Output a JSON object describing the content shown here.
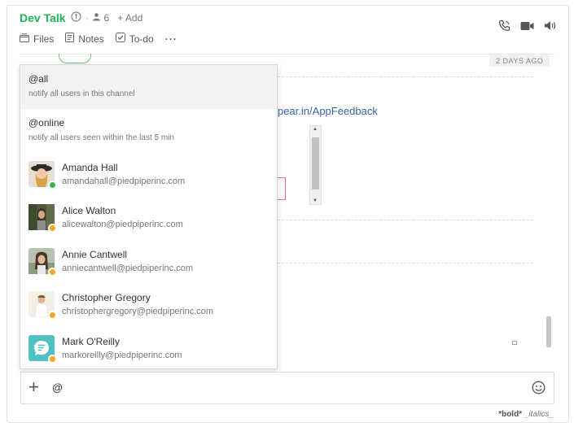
{
  "header": {
    "channel_name": "Dev Talk",
    "member_count": "6",
    "add_label": "+ Add",
    "tabs": [
      {
        "label": "Files",
        "icon": "files-icon"
      },
      {
        "label": "Notes",
        "icon": "notes-icon"
      },
      {
        "label": "To-do",
        "icon": "todo-icon"
      }
    ],
    "more": "···"
  },
  "timeline": {
    "date_pill": "2 DAYS AGO",
    "partial_link": "pear.in/AppFeedback"
  },
  "mention_popup": {
    "options": [
      {
        "handle": "@all",
        "desc": "notify all users in this channel"
      },
      {
        "handle": "@online",
        "desc": "notify all users seen within the last 5 min"
      }
    ],
    "users": [
      {
        "name": "Amanda Hall",
        "email": "amandahall@piedpiperinc.com",
        "status": "online"
      },
      {
        "name": "Alice Walton",
        "email": "alicewalton@piedpiperinc.com",
        "status": "away"
      },
      {
        "name": "Annie Cantwell",
        "email": "anniecantwell@piedpiperinc.com",
        "status": "away"
      },
      {
        "name": "Christopher Gregory",
        "email": "christophergregory@piedpiperinc.com",
        "status": "away"
      },
      {
        "name": "Mark O'Reilly",
        "email": "markoreilly@piedpiperinc.com",
        "status": "away"
      }
    ]
  },
  "composer": {
    "value": "@",
    "format_hint_bold": "*bold*",
    "format_hint_italic": "_italics_"
  },
  "colors": {
    "brand_green": "#1fb35a",
    "online": "#2db84d",
    "away": "#f5a623",
    "link": "#3a5fa5"
  }
}
